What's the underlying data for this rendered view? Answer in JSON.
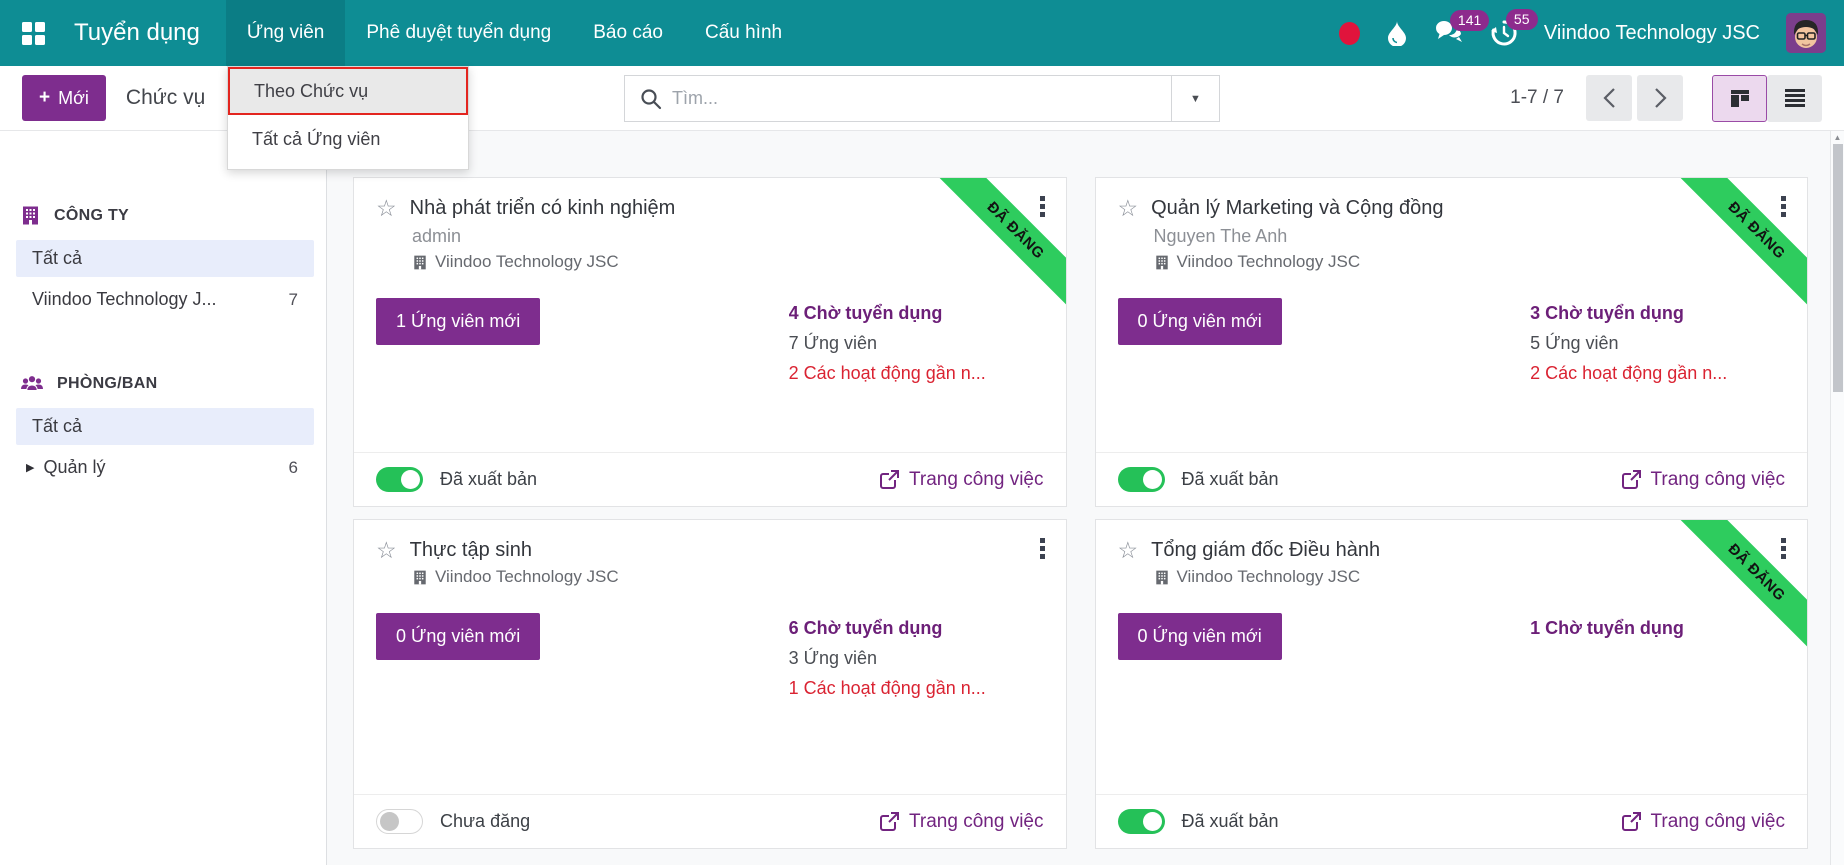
{
  "nav": {
    "brand": "Tuyển dụng",
    "items": [
      {
        "label": "Ứng viên",
        "active": true
      },
      {
        "label": "Phê duyệt tuyển dụng",
        "active": false
      },
      {
        "label": "Báo cáo",
        "active": false
      },
      {
        "label": "Cấu hình",
        "active": false
      }
    ],
    "chat_badge": "141",
    "activity_badge": "55",
    "company": "Viindoo Technology JSC"
  },
  "control": {
    "new_button": "Mới",
    "breadcrumb": "Chức vụ",
    "search_placeholder": "Tìm...",
    "pager": "1-7 / 7"
  },
  "dropdown": {
    "items": [
      {
        "label": "Theo Chức vụ",
        "highlighted": true
      },
      {
        "label": "Tất cả Ứng viên",
        "highlighted": false
      }
    ]
  },
  "sidebar": {
    "sections": [
      {
        "title": "CÔNG TY",
        "items": [
          {
            "label": "Tất cả",
            "selected": true
          },
          {
            "label": "Viindoo Technology J...",
            "count": "7"
          }
        ]
      },
      {
        "title": "PHÒNG/BAN",
        "items": [
          {
            "label": "Tất cả",
            "selected": true
          },
          {
            "label": "Quản lý",
            "count": "6",
            "expandable": true
          }
        ]
      }
    ]
  },
  "cards": [
    {
      "title": "Nhà phát triển có kinh nghiệm",
      "recruiter": "admin",
      "company": "Viindoo Technology JSC",
      "new_applicants": "1 Ứng viên mới",
      "stats": [
        {
          "text": "4 Chờ tuyển dụng",
          "style": "purple"
        },
        {
          "text": "7 Ứng viên",
          "style": "plain"
        },
        {
          "text": "2 Các hoạt động gần n...",
          "style": "red"
        }
      ],
      "published": true,
      "publish_label": "Đã xuất bản",
      "website_label": "Trang công việc",
      "ribbon": "ĐÃ ĐĂNG"
    },
    {
      "title": "Quản lý Marketing và Cộng đồng",
      "recruiter": "Nguyen The Anh",
      "company": "Viindoo Technology JSC",
      "new_applicants": "0 Ứng viên mới",
      "stats": [
        {
          "text": "3 Chờ tuyển dụng",
          "style": "purple"
        },
        {
          "text": "5 Ứng viên",
          "style": "plain"
        },
        {
          "text": "2 Các hoạt động gần n...",
          "style": "red"
        }
      ],
      "published": true,
      "publish_label": "Đã xuất bản",
      "website_label": "Trang công việc",
      "ribbon": "ĐÃ ĐĂNG"
    },
    {
      "title": "Thực tập sinh",
      "recruiter": null,
      "company": "Viindoo Technology JSC",
      "new_applicants": "0 Ứng viên mới",
      "stats": [
        {
          "text": "6 Chờ tuyển dụng",
          "style": "purple"
        },
        {
          "text": "3 Ứng viên",
          "style": "plain"
        },
        {
          "text": "1 Các hoạt động gần n...",
          "style": "red"
        }
      ],
      "published": false,
      "publish_label": "Chưa đăng",
      "website_label": "Trang công việc",
      "ribbon": null
    },
    {
      "title": "Tổng giám đốc Điều hành",
      "recruiter": null,
      "company": "Viindoo Technology JSC",
      "new_applicants": "0 Ứng viên mới",
      "stats": [
        {
          "text": "1 Chờ tuyển dụng",
          "style": "purple"
        }
      ],
      "published": true,
      "publish_label": "Đã xuất bản",
      "website_label": "Trang công việc",
      "ribbon": "ĐÃ ĐĂNG"
    }
  ],
  "icons": {
    "star": "☆",
    "caret": "▶",
    "select_arrow": "▼",
    "scroll_up": "▲"
  },
  "colors": {
    "navbar_teal": "#0e8d94",
    "primary_purple": "#7e2d8e",
    "stat_purple": "#6c1f78",
    "link_purple": "#722480",
    "danger_red": "#da2332",
    "ribbon_green": "#2ecc5e",
    "toggle_green": "#25c158",
    "badge_purple": "#8d2b8d",
    "selected_item_bg": "#e8edfb"
  }
}
